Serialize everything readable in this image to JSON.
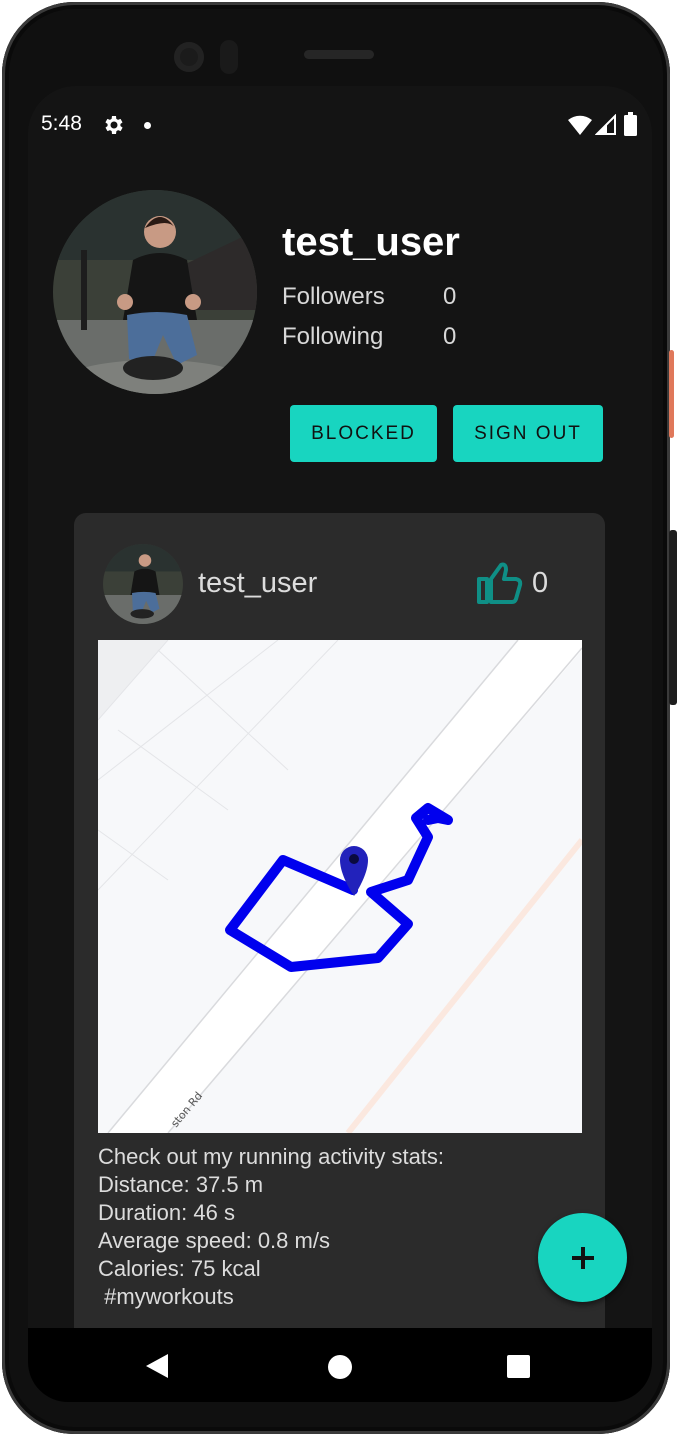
{
  "status_bar": {
    "time": "5:48",
    "icons": [
      "gear-icon",
      "notification-dot",
      "wifi-icon",
      "signal-icon",
      "battery-icon"
    ]
  },
  "profile": {
    "username": "test_user",
    "followers_label": "Followers",
    "followers_count": "0",
    "following_label": "Following",
    "following_count": "0",
    "blocked_button": "BLOCKED",
    "sign_out_button": "SIGN OUT"
  },
  "post": {
    "username": "test_user",
    "likes": "0",
    "map_street_label": "ston Rd",
    "description": "Check out my running activity stats:\nDistance: 37.5 m\nDuration: 46 s\nAverage speed: 0.8 m/s\nCalories: 75 kcal\n #myworkouts"
  },
  "fab_label": "+",
  "colors": {
    "accent": "#18d5c0",
    "route": "#0000ee",
    "background": "#141414",
    "card": "#2b2b2b"
  }
}
